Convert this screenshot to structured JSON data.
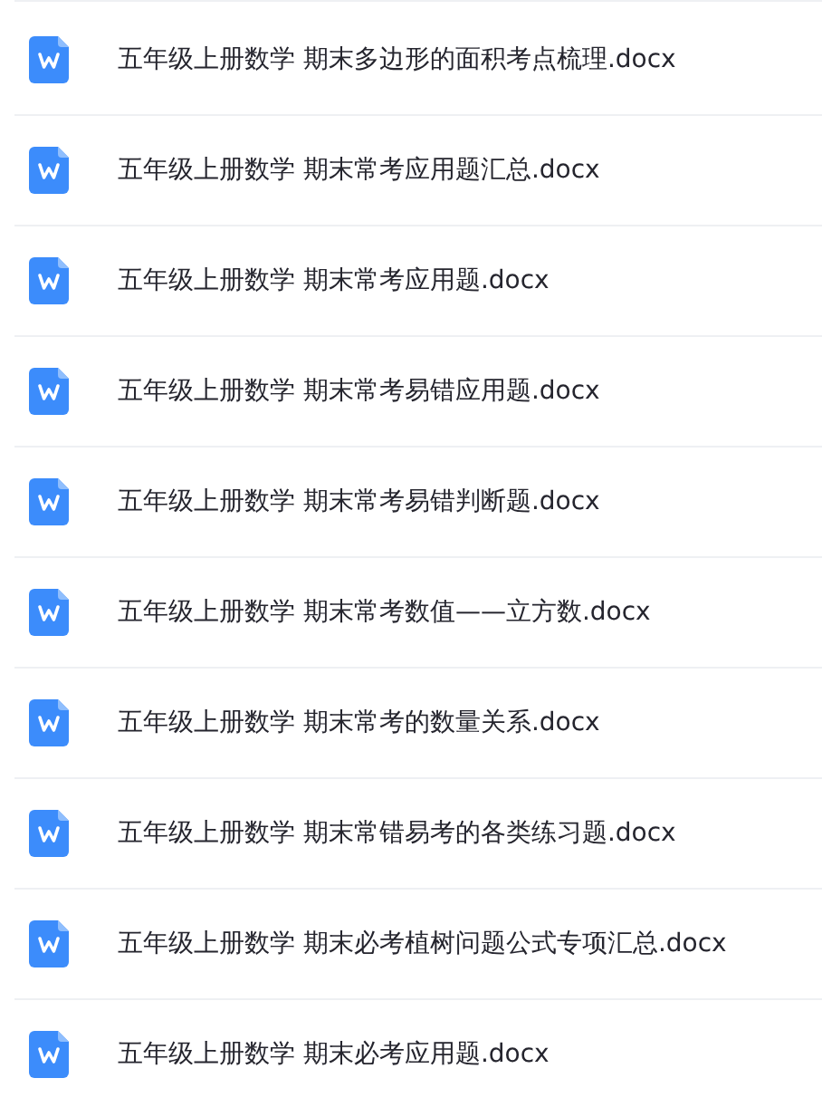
{
  "files": [
    {
      "name": "五年级上册数学 期末多边形的面积考点梳理.docx"
    },
    {
      "name": "五年级上册数学 期末常考应用题汇总.docx"
    },
    {
      "name": "五年级上册数学 期末常考应用题.docx"
    },
    {
      "name": "五年级上册数学 期末常考易错应用题.docx"
    },
    {
      "name": "五年级上册数学 期末常考易错判断题.docx"
    },
    {
      "name": "五年级上册数学 期末常考数值——立方数.docx"
    },
    {
      "name": "五年级上册数学 期末常考的数量关系.docx"
    },
    {
      "name": "五年级上册数学 期末常错易考的各类练习题.docx"
    },
    {
      "name": "五年级上册数学 期末必考植树问题公式专项汇总.docx"
    },
    {
      "name": "五年级上册数学 期末必考应用题.docx"
    }
  ]
}
